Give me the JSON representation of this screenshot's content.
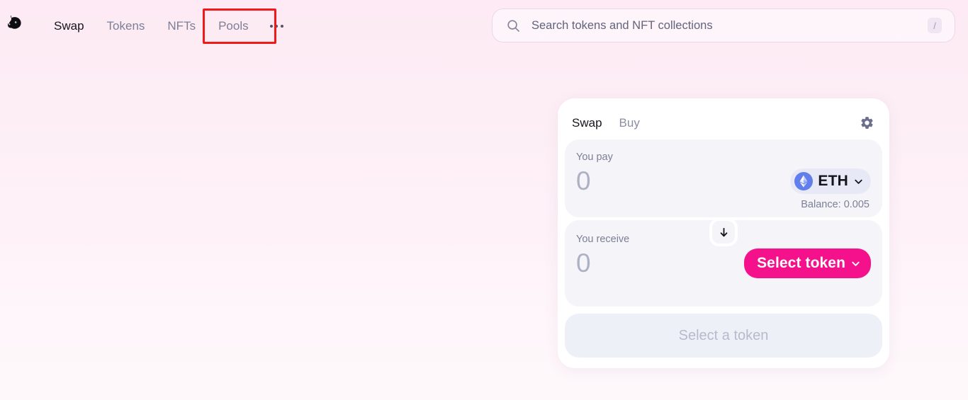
{
  "header": {
    "logo_name": "uniswap-unicorn-logo",
    "nav": [
      {
        "label": "Swap",
        "active": true
      },
      {
        "label": "Tokens",
        "active": false
      },
      {
        "label": "NFTs",
        "active": false
      },
      {
        "label": "Pools",
        "active": false
      }
    ],
    "more_menu_label": "more-menu"
  },
  "search": {
    "placeholder": "Search tokens and NFT collections",
    "value": "",
    "shortcut": "/"
  },
  "swap_card": {
    "tabs": [
      {
        "label": "Swap",
        "active": true
      },
      {
        "label": "Buy",
        "active": false
      }
    ],
    "settings_label": "Settings",
    "pay": {
      "label": "You pay",
      "amount": "0",
      "token": "ETH",
      "balance": "Balance: 0.005"
    },
    "receive": {
      "label": "You receive",
      "amount": "0",
      "select_token_label": "Select token"
    },
    "action_button": "Select a token"
  },
  "colors": {
    "background_top": "#fdeaf4",
    "background_bottom": "#fef8fb",
    "accent_pink": "#f5118c",
    "annotation_red": "#f01a1a",
    "panel_gray": "#f4f4f9",
    "eth_blue": "#627eea",
    "text_dark": "#15151c",
    "text_muted": "#7c7f96"
  }
}
